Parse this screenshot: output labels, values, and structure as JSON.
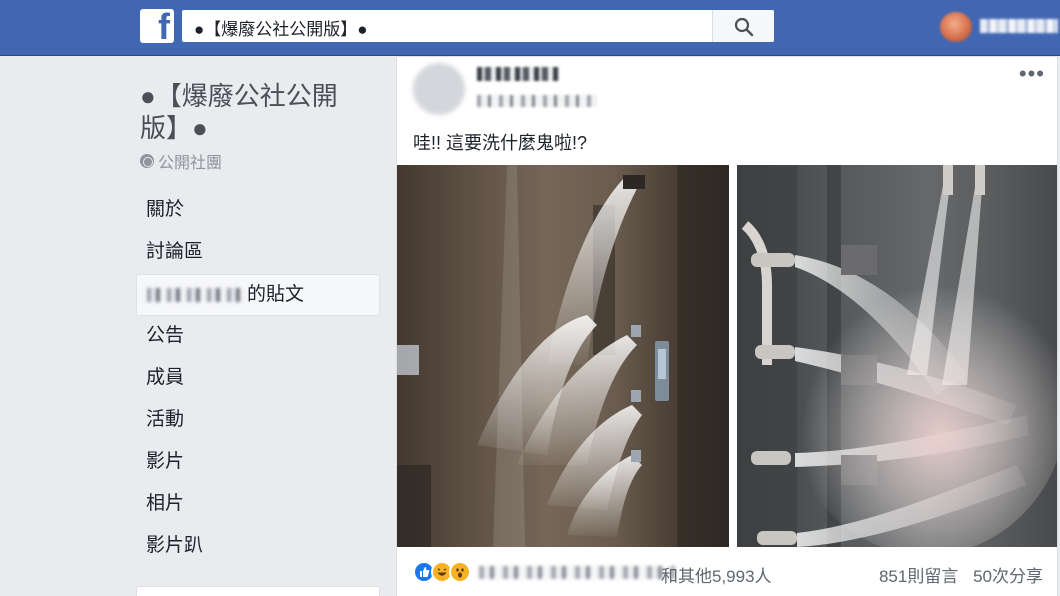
{
  "header": {
    "logo": "f",
    "search_value": "●【爆廢公社公開版】●",
    "search_icon": "search-icon"
  },
  "group": {
    "title": "●【爆廢公社公開版】●",
    "privacy": "公開社團"
  },
  "nav": {
    "items": [
      {
        "label": "關於"
      },
      {
        "label": "討論區"
      },
      {
        "label": "的貼文",
        "active": true
      },
      {
        "label": "公告"
      },
      {
        "label": "成員"
      },
      {
        "label": "活動"
      },
      {
        "label": "影片"
      },
      {
        "label": "相片"
      },
      {
        "label": "影片趴"
      }
    ]
  },
  "post": {
    "text": "哇!! 這要洗什麼鬼啦!?",
    "more": "•••",
    "reactions_others": "和其他5,993人",
    "comments": "851則留言",
    "shares": "50次分享"
  },
  "colors": {
    "brand": "#4267b2",
    "like": "#1877f2",
    "haha": "#f7b125"
  }
}
